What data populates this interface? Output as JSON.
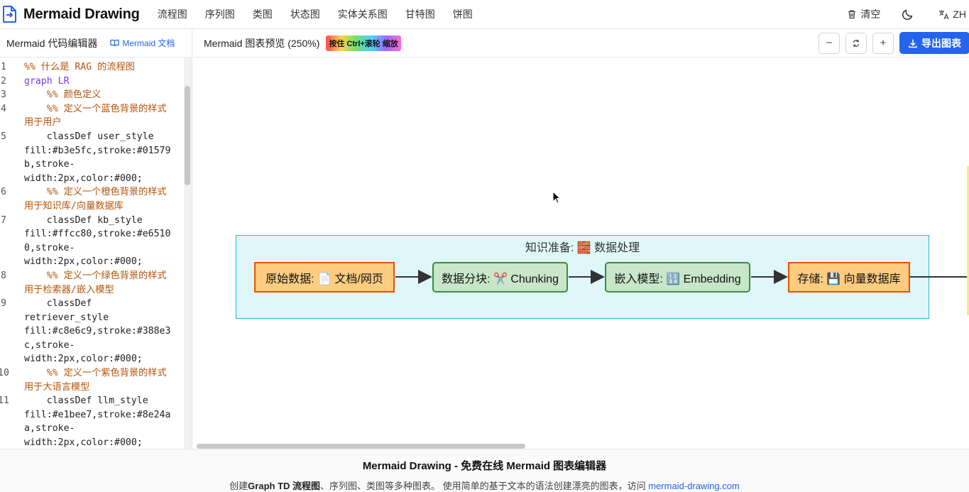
{
  "app": {
    "title": "Mermaid Drawing",
    "nav": [
      "流程图",
      "序列图",
      "类图",
      "状态图",
      "实体关系图",
      "甘特图",
      "饼图"
    ],
    "clear_label": "清空",
    "lang_label": "ZH"
  },
  "editor": {
    "title": "Mermaid 代码编辑器",
    "docs_link": "Mermaid 文档",
    "lines": [
      {
        "n": "1",
        "rows": [
          {
            "t": "%% 什么是 RAG 的流程图",
            "c": "comment"
          }
        ]
      },
      {
        "n": "2",
        "rows": [
          {
            "t": "graph LR",
            "c": "kw"
          }
        ]
      },
      {
        "n": "3",
        "rows": [
          {
            "t": "    %% 颜色定义",
            "c": "comment"
          }
        ]
      },
      {
        "n": "4",
        "rows": [
          {
            "t": "    %% 定义一个蓝色背景的样式",
            "c": "comment"
          },
          {
            "t": "用于用户",
            "c": "comment"
          }
        ]
      },
      {
        "n": "5",
        "rows": [
          {
            "t": "    classDef user_style",
            "c": "plain"
          },
          {
            "t": "fill:#b3e5fc,stroke:#01579",
            "c": "plain"
          },
          {
            "t": "b,stroke-",
            "c": "plain"
          },
          {
            "t": "width:2px,color:#000;",
            "c": "plain"
          }
        ]
      },
      {
        "n": "6",
        "rows": [
          {
            "t": "    %% 定义一个橙色背景的样式",
            "c": "comment"
          },
          {
            "t": "用于知识库/向量数据库",
            "c": "comment"
          }
        ]
      },
      {
        "n": "7",
        "rows": [
          {
            "t": "    classDef kb_style",
            "c": "plain"
          },
          {
            "t": "fill:#ffcc80,stroke:#e6510",
            "c": "plain"
          },
          {
            "t": "0,stroke-",
            "c": "plain"
          },
          {
            "t": "width:2px,color:#000;",
            "c": "plain"
          }
        ]
      },
      {
        "n": "8",
        "rows": [
          {
            "t": "    %% 定义一个绿色背景的样式",
            "c": "comment"
          },
          {
            "t": "用于检索器/嵌入模型",
            "c": "comment"
          }
        ]
      },
      {
        "n": "9",
        "rows": [
          {
            "t": "    classDef",
            "c": "plain"
          },
          {
            "t": "retriever_style",
            "c": "plain"
          },
          {
            "t": "fill:#c8e6c9,stroke:#388e3",
            "c": "plain"
          },
          {
            "t": "c,stroke-",
            "c": "plain"
          },
          {
            "t": "width:2px,color:#000;",
            "c": "plain"
          }
        ]
      },
      {
        "n": "10",
        "rows": [
          {
            "t": "    %% 定义一个紫色背景的样式",
            "c": "comment"
          },
          {
            "t": "用于大语言模型",
            "c": "comment"
          }
        ]
      },
      {
        "n": "11",
        "rows": [
          {
            "t": "    classDef llm_style",
            "c": "plain"
          },
          {
            "t": "fill:#e1bee7,stroke:#8e24a",
            "c": "plain"
          },
          {
            "t": "a,stroke-",
            "c": "plain"
          },
          {
            "t": "width:2px,color:#000;",
            "c": "plain"
          }
        ]
      }
    ]
  },
  "preview": {
    "title": "Mermaid 图表预览 (250%)",
    "hint": "按住 Ctrl+滚轮 缩放",
    "zoom_out": "−",
    "zoom_in": "+",
    "export_label": "导出图表",
    "subgraph_title": "知识准备: 🧱 数据处理",
    "nodes": [
      {
        "label": "原始数据: 📄 文档/网页",
        "style": "orange"
      },
      {
        "label": "数据分块: ✂️ Chunking",
        "style": "green"
      },
      {
        "label": "嵌入模型: 🔢 Embedding",
        "style": "green"
      },
      {
        "label": "存储: 💾 向量数据库",
        "style": "orange"
      }
    ]
  },
  "footer": {
    "title": "Mermaid Drawing - 免费在线 Mermaid 图表编辑器",
    "desc_prefix": "创建",
    "desc_bold": "Graph TD 流程图",
    "desc_rest": "、序列图、类图等多种图表。 使用简单的基于文本的语法创建漂亮的图表，访问 ",
    "link": "mermaid-drawing.com"
  },
  "colors": {
    "accent": "#2563eb",
    "kb_fill": "#ffcc80",
    "kb_stroke": "#e65100",
    "retriever_fill": "#c8e6c9",
    "retriever_stroke": "#388e3c",
    "subgraph_fill": "#e0f7fa",
    "subgraph_stroke": "#2cb6c4"
  },
  "icons": [
    "logo-file-icon",
    "trash-icon",
    "moon-icon",
    "translate-icon",
    "book-icon",
    "reset-icon",
    "download-icon"
  ]
}
